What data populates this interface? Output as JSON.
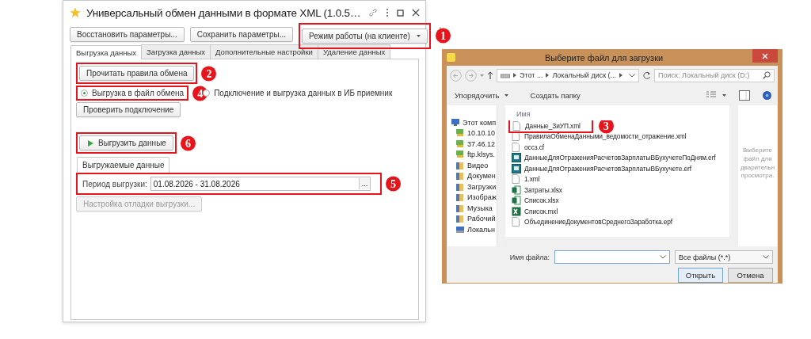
{
  "main_window": {
    "title": "Универсальный обмен данными в формате XML (1.0.5…",
    "favorite": true,
    "toolbar": [
      {
        "label": "Восстановить параметры...",
        "kind": "button"
      },
      {
        "label": "Сохранить параметры...",
        "kind": "button"
      },
      {
        "label": "Режим работы (на клиенте)",
        "kind": "dropdown",
        "callout": "1"
      }
    ],
    "tabs": [
      {
        "label": "Выгрузка данных",
        "selected": true
      },
      {
        "label": "Загрузка данных",
        "selected": false
      },
      {
        "label": "Дополнительные настройки",
        "selected": false
      },
      {
        "label": "Удаление данных",
        "selected": false
      }
    ],
    "read_rules_button": {
      "label": "Прочитать правила обмена",
      "callout": "2"
    },
    "export_modes": [
      {
        "label": "Выгрузка в файл обмена",
        "selected": true,
        "callout": "4"
      },
      {
        "label": "Подключение и выгрузка данных в ИБ приемник",
        "selected": false
      }
    ],
    "check_connection_button": {
      "label": "Проверить подключение"
    },
    "export_button": {
      "label": "Выгрузить данные",
      "callout": "6"
    },
    "subtabs": [
      {
        "label": "Выгружаемые данные",
        "selected": true
      }
    ],
    "period": {
      "label": "Период выгрузки:",
      "value": "01.08.2026 - 31.08.2026",
      "select_label": "...",
      "callout": "5"
    },
    "debug_button": {
      "label": "Настройка отладки выгрузки...",
      "disabled": true
    }
  },
  "file_dialog": {
    "title": "Выберите файл для загрузки",
    "path": [
      "Этот ...",
      "Локальный диск (..."
    ],
    "search": {
      "placeholder": "Поиск: Локальный диск (D:)"
    },
    "toolbar": [
      {
        "label": "Упорядочить",
        "kind": "menu"
      },
      {
        "label": "Создать папку",
        "kind": "button"
      }
    ],
    "nav": [
      {
        "label": "Этот комп",
        "kind": "computer"
      },
      {
        "label": "10.10.10",
        "kind": "network"
      },
      {
        "label": "37.46.12",
        "kind": "network"
      },
      {
        "label": "ftp.klsys.",
        "kind": "network"
      },
      {
        "label": "Видео",
        "kind": "folder"
      },
      {
        "label": "Докумен",
        "kind": "folder"
      },
      {
        "label": "Загрузки",
        "kind": "folder"
      },
      {
        "label": "Изображ",
        "kind": "folder"
      },
      {
        "label": "Музыка",
        "kind": "folder"
      },
      {
        "label": "Рабочий",
        "kind": "folder"
      },
      {
        "label": "Локальн",
        "kind": "drive"
      }
    ],
    "column": "Имя",
    "files": [
      {
        "name": "Данные_ЗиУП.xml",
        "kind": "doc",
        "callout": "3"
      },
      {
        "name": "ПравилаОбменаДанными_ведомости_отражение.xml",
        "kind": "doc"
      },
      {
        "name": "occз.cf",
        "kind": "doc"
      },
      {
        "name": "ДанныеДляОтраженияРасчетовЗарплатыВБухучетеПоДням.erf",
        "kind": "report"
      },
      {
        "name": "ДанныеДляОтраженияРасчетовЗарплатыВБухучете.erf",
        "kind": "report"
      },
      {
        "name": "1.xml",
        "kind": "doc"
      },
      {
        "name": "Затраты.xlsx",
        "kind": "sheet"
      },
      {
        "name": "Список.xlsx",
        "kind": "sheet"
      },
      {
        "name": "Список.mxl",
        "kind": "excel"
      },
      {
        "name": "ОбъединениеДокументовСреднегоЗаработка.epf",
        "kind": "doc"
      }
    ],
    "preview_text": "Выберите файл для дварительн просмотра.",
    "file_name_label": "Имя файла:",
    "file_type": "Все файлы (*.*)",
    "buttons": [
      "Открыть",
      "Отмена"
    ]
  }
}
